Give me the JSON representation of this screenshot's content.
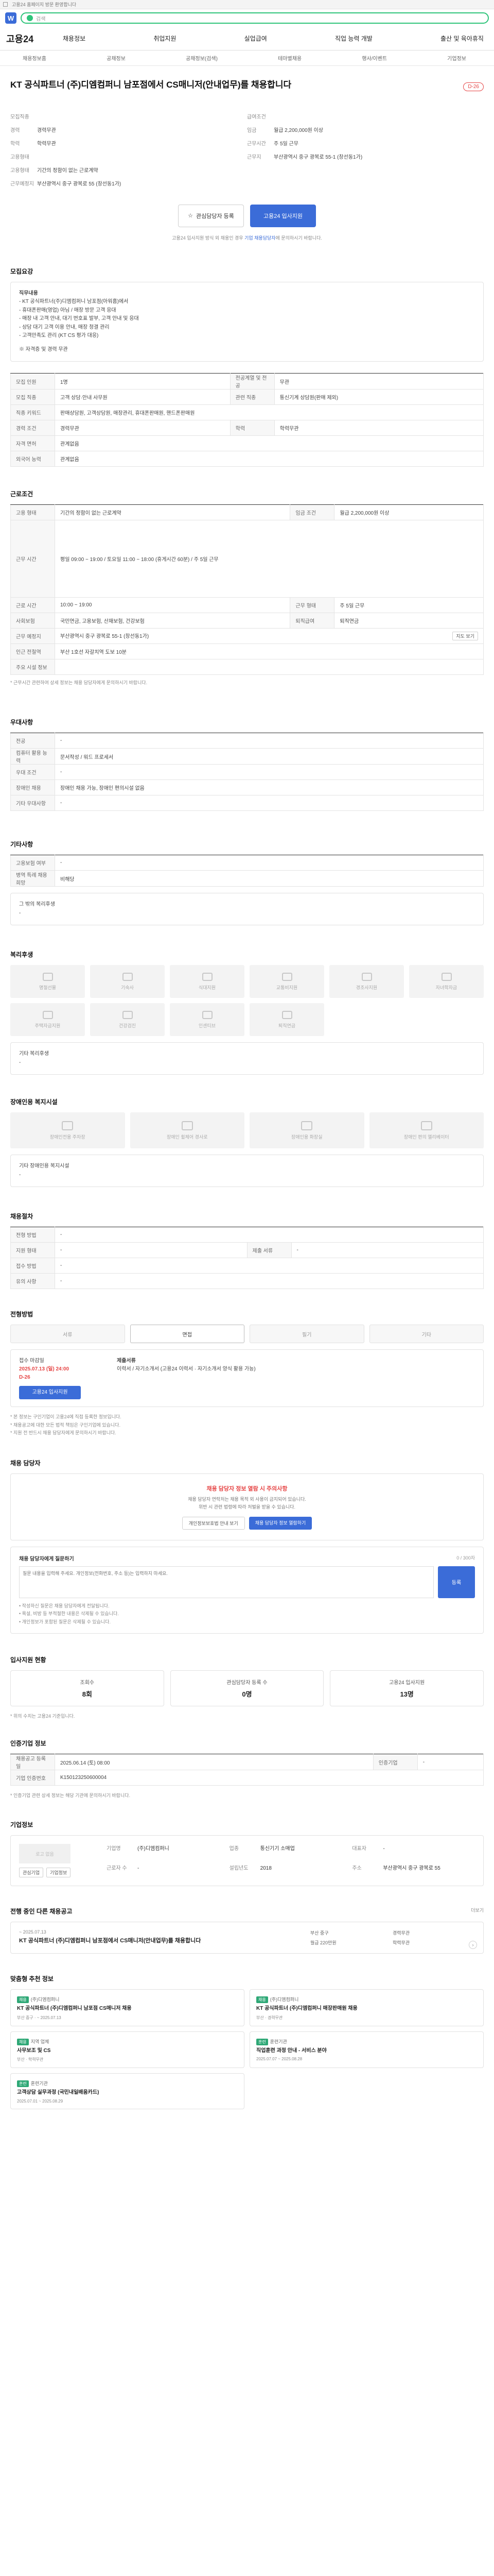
{
  "top": {
    "util_text": "고용24 홈페이지 방문 환영합니다",
    "search_placeholder": "검색"
  },
  "gnb": {
    "brand": "고용24",
    "menu": [
      "채용정보",
      "취업지원",
      "실업급여",
      "직업 능력 개발",
      "출산 및 육아휴직"
    ]
  },
  "subnav": [
    "채용정보홈",
    "공채정보",
    "공채정보(검색)",
    "테마별채용",
    "행사/이벤트",
    "기업정보"
  ],
  "header": {
    "title": "KT 공식파트너 (주)디엠컴퍼니 남포점에서 CS매니저(안내업무)를 채용합니다",
    "dday": "D-26"
  },
  "summary": {
    "left": [
      {
        "k": "모집직종",
        "v": ""
      },
      {
        "k": "경력",
        "v": "경력무관"
      },
      {
        "k": "학력",
        "v": "학력무관"
      },
      {
        "k": "고용형태",
        "v": ""
      },
      {
        "k": "고용형태",
        "v": "기간의 정함이 없는 근로계약"
      },
      {
        "k": "근무예정지",
        "v": "부산광역시 중구 광복로 55 (창선동1가)"
      }
    ],
    "right": [
      {
        "k": "급여조건",
        "v": ""
      },
      {
        "k": "임금",
        "v": "월급 2,200,000원 이상"
      },
      {
        "k": "근무시간",
        "v": "주 5일 근무"
      },
      {
        "k": "근무지",
        "v": "부산광역시 중구 광복로 55-1 (창선동1가)"
      }
    ]
  },
  "actions": {
    "interest": "관심담당자 등록",
    "apply": "고용24 입사지원",
    "notice_pre": "고용24 입사지원 방식 외 채용인 경우 ",
    "notice_link": "기업 채용담당자",
    "notice_post": "에 문의하시기 바랍니다."
  },
  "job_content": {
    "title": "모집요강",
    "lines": [
      "직무내용",
      "- KT 공식파트너(주)디엠컴퍼니 남포점(아워홈)에서",
      "- 휴대폰판매(영업) 아님 / 매장 방문 고객 응대",
      "- 매장 내 고객 안내, 대기 번호표 발부, 고객 안내 및 응대",
      "- 상담 대기 고객 이용 안내, 매장 청결 관리",
      "- 고객만족도 관리 (KT CS 평가 대응)",
      "",
      "※ 자격증 및 경력 무관"
    ]
  },
  "recruit_table": {
    "rows": [
      [
        {
          "k": "모집 인원",
          "v": "1명"
        },
        {
          "k": "전공계열 및 전공",
          "v": "무관"
        }
      ],
      [
        {
          "k": "모집 직종",
          "v": "고객 상담·안내 사무원"
        },
        {
          "k": "관련 직종",
          "v": "통신기계 상담원(판매 제외)"
        }
      ],
      [
        {
          "k": "직종 키워드",
          "v": "판매상담원, 고객상담원, 매장관리, 휴대폰판매원, 핸드폰판매원"
        },
        {
          "k": "",
          "v": ""
        }
      ],
      [
        {
          "k": "경력 조건",
          "v": "경력무관"
        },
        {
          "k": "학력",
          "v": "학력무관"
        }
      ],
      [
        {
          "k": "자격 면허",
          "v": "관계없음"
        },
        {
          "k": "",
          "v": ""
        }
      ],
      [
        {
          "k": "외국어 능력",
          "v": "관계없음"
        },
        {
          "k": "",
          "v": ""
        }
      ]
    ]
  },
  "work_cond": {
    "title": "근로조건",
    "rows": [
      {
        "k": "고용 형태",
        "v": "기간의 정함이 없는 근로계약",
        "k2": "임금 조건",
        "v2": "월급 2,200,000원 이상"
      },
      {
        "k": "",
        "v": "",
        "k2": "",
        "v2": ""
      },
      {
        "k": "근무 시간",
        "v": "평일 09:00 ~ 19:00 / 토요일 11:00 ~ 18:00 (휴게시간 60분) / 주 5일 근무",
        "k2": "",
        "v2": ""
      },
      {
        "k": "근로 시간",
        "v": "10:00 ~ 19:00",
        "k2": "근무 형태",
        "v2": "주 5일 근무"
      },
      {
        "k": "사회보험",
        "v": "국민연금, 고용보험, 산재보험, 건강보험",
        "k2": "퇴직급여",
        "v2": "퇴직연금"
      },
      {
        "k": "근무 예정지",
        "v": "부산광역시 중구 광복로 55-1 (창선동1가)",
        "k2": "",
        "v2": "지도 보기"
      },
      {
        "k": "인근 전철역",
        "v": "부산 1호선 자갈치역 도보 10분",
        "k2": "",
        "v2": ""
      },
      {
        "k": "주요 시설 정보",
        "v": "",
        "k2": "",
        "v2": ""
      }
    ],
    "note": "* 근무시간 관련하여 상세 정보는 채용 담당자에게 문의하시기 바랍니다."
  },
  "benefits": {
    "title": "우대사항",
    "rows": [
      {
        "k": "전공",
        "v": "-"
      },
      {
        "k": "컴퓨터 활용 능력",
        "v": "문서작성 / 워드 프로세서"
      },
      {
        "k": "우대 조건",
        "v": "-"
      },
      {
        "k": "장애인 채용",
        "v": "장애인 채용 가능, 장애인 편의시설 없음"
      },
      {
        "k": "기타 우대사항",
        "v": "-"
      }
    ]
  },
  "other": {
    "title": "기타사항",
    "rows": [
      {
        "k": "고용보험 여부",
        "v": "-"
      },
      {
        "k": "병역 특례 채용 희망",
        "v": "비해당"
      }
    ],
    "extra_title": "그 밖의 복리후생",
    "extra_v": "-"
  },
  "welfare": {
    "title": "복리후생",
    "tiles": [
      "명절선물",
      "기숙사",
      "식대지원",
      "교통비지원",
      "경조사지원",
      "자녀학자금",
      "주택자금지원",
      "건강검진",
      "인센티브",
      "퇴직연금"
    ],
    "extra_title": "기타 복리후생",
    "extra_v": "-"
  },
  "disabled": {
    "title": "장애인용 복지시설",
    "tiles": [
      "장애인전용 주차장",
      "장애인 휠체어 경사로",
      "장애인용 화장실",
      "장애인 편의 엘리베이터"
    ],
    "extra_title": "기타 장애인용 복지시설",
    "extra_v": "-"
  },
  "method": {
    "title": "채용절차",
    "rows": [
      {
        "k": "전형 방법",
        "v": "-",
        "k2": "",
        "v2": ""
      },
      {
        "k": "지원 형태",
        "v": "-",
        "k2": "제출 서류",
        "v2": "-"
      },
      {
        "k": "접수 방법",
        "v": "-",
        "k2": "",
        "v2": ""
      },
      {
        "k": "유의 사항",
        "v": "-",
        "k2": "",
        "v2": ""
      }
    ]
  },
  "prefer": {
    "title": "전형방법",
    "items": [
      "서류",
      "면접",
      "필기",
      "기타"
    ],
    "active": 1
  },
  "procedure": {
    "title_red": "접수 마감일",
    "date": "2025.07.13 (일) 24:00",
    "days": "D-26",
    "apply": "고용24 입사지원",
    "right_title": "제출서류",
    "right_text": "이력서 / 자기소개서 (고용24 이력서 · 자기소개서 양식 활용 가능)"
  },
  "notes": [
    "* 본 정보는 구인기업이 고용24에 직접 등록한 정보입니다.",
    "* 채용공고에 대한 모든 법적 책임은 구인기업에 있습니다.",
    "* 지원 전 반드시 채용 담당자에게 문의하시기 바랍니다."
  ],
  "qa": {
    "title": "채용 담당자",
    "alert": "채용 담당자 정보 열람 시 주의사항",
    "desc1": "채용 담당자 연락처는 채용 목적 외 사용이 금지되어 있습니다.",
    "desc2": "위반 시 관련 법령에 따라 처벌을 받을 수 있습니다.",
    "b1": "개인정보보호법 안내 보기",
    "b2": "채용 담당자 정보 열람하기"
  },
  "ask": {
    "title": "채용 담당자에게 질문하기",
    "limit": "0 / 300자",
    "placeholder": "질문 내용을 입력해 주세요. 개인정보(전화번호, 주소 등)는 입력하지 마세요.",
    "send": "등록",
    "bullets": [
      "• 작성하신 질문은 채용 담당자에게 전달됩니다.",
      "• 욕설, 비방 등 부적절한 내용은 삭제될 수 있습니다.",
      "• 개인정보가 포함된 질문은 삭제될 수 있습니다."
    ]
  },
  "stats": {
    "title": "입사지원 현황",
    "items": [
      {
        "label": "조회수",
        "n": "8회"
      },
      {
        "label": "관심담당자 등록 수",
        "n": "0명"
      },
      {
        "label": "고용24 입사지원",
        "n": "13명"
      }
    ],
    "note": "* 위의 수치는 고용24 기준입니다."
  },
  "basic": {
    "title": "인증기업 정보",
    "rows": [
      {
        "k": "채용공고 등록일",
        "v": "2025.06.14 (토) 08:00",
        "k2": "인증기업",
        "v2": "-"
      },
      {
        "k": "기업 인증번호",
        "v": "K150123250600004",
        "k2": "",
        "v2": ""
      }
    ],
    "note": "* 인증기업 관련 상세 정보는 해당 기관에 문의하시기 바랍니다."
  },
  "company": {
    "title": "기업정보",
    "logo_alt": "로고 없음",
    "btn1": "관심기업",
    "btn2": "기업정보",
    "grid": [
      {
        "k": "기업명",
        "v": "(주)디엠컴퍼니"
      },
      {
        "k": "업종",
        "v": "통신기기 소매업"
      },
      {
        "k": "대표자",
        "v": "-"
      },
      {
        "k": "근로자 수",
        "v": "-"
      },
      {
        "k": "설립년도",
        "v": "2018"
      },
      {
        "k": "주소",
        "v": "부산광역시 중구 광복로 55"
      }
    ]
  },
  "similar": {
    "title": "전행 중인 다른 채용공고",
    "more": "더보기",
    "date": "~ 2025.07.13",
    "ttl": "KT 공식파트너 (주)디엠컴퍼니 남포점에서 CS매니저(안내업무)를 채용합니다",
    "meta": [
      "부산 중구",
      "경력무관",
      "월급 220만원",
      "학력무관"
    ]
  },
  "recommend": {
    "title": "맞춤형 추천 정보",
    "cards": [
      {
        "tag": "채용",
        "cmp": "(주)디엠컴퍼니",
        "ttl": "KT 공식파트너 (주)디엠컴퍼니 남포점 CS매니저 채용",
        "meta": "부산 중구 · ~ 2025.07.13"
      },
      {
        "tag": "채용",
        "cmp": "(주)디엠컴퍼니",
        "ttl": "KT 공식파트너 (주)디엠컴퍼니 매장판매원 채용",
        "meta": "부산 · 경력무관"
      },
      {
        "tag": "채용",
        "cmp": "지역 업체",
        "ttl": "사무보조 및 CS",
        "meta": "부산 · 학력무관"
      },
      {
        "tag": "훈련",
        "cmp": "훈련기관",
        "ttl": "직업훈련 과정 안내 - 서비스 분야",
        "meta": "2025.07.07 ~ 2025.08.28"
      },
      {
        "tag": "훈련",
        "cmp": "훈련기관",
        "ttl": "고객상담 실무과정 (국민내일배움카드)",
        "meta": "2025.07.01 ~ 2025.08.29"
      }
    ]
  }
}
